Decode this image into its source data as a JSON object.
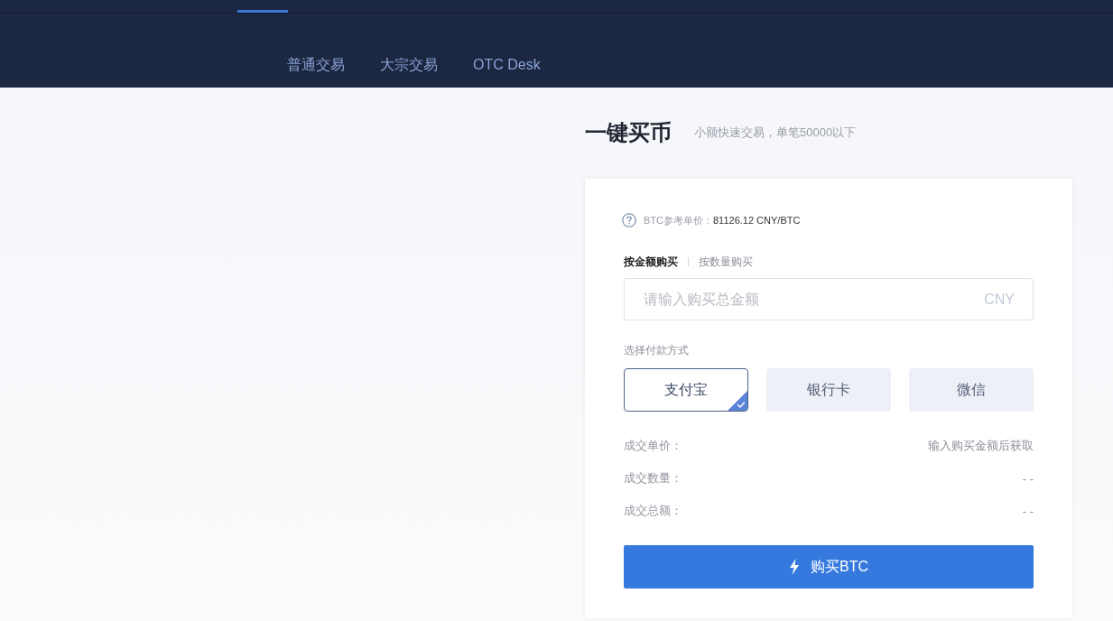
{
  "top_nav": {
    "tabs": [
      {
        "selected": true
      },
      {
        "selected": false
      },
      {
        "selected": false
      },
      {
        "selected": false
      }
    ]
  },
  "sub_nav": [
    {
      "label": "普通交易"
    },
    {
      "label": "大宗交易"
    },
    {
      "label": "OTC Desk"
    }
  ],
  "quick_buy": {
    "title": "一键买币",
    "subtitle": "小额快速交易，单笔50000以下",
    "reference_price": {
      "label": "BTC参考单价：",
      "value": "81126.12 CNY/BTC"
    },
    "modes": [
      {
        "label": "按金额购买",
        "selected": true
      },
      {
        "label": "按数量购买",
        "selected": false
      }
    ],
    "amount_field": {
      "placeholder": "请输入购买总金额",
      "unit": "CNY"
    },
    "payment_label": "选择付款方式",
    "payment_methods": [
      {
        "label": "支付宝",
        "selected": true
      },
      {
        "label": "银行卡",
        "selected": false
      },
      {
        "label": "微信",
        "selected": false
      }
    ],
    "summary": [
      {
        "label": "成交单价：",
        "value": "输入购买金额后获取"
      },
      {
        "label": "成交数量：",
        "value": "- -"
      },
      {
        "label": "成交总额：",
        "value": "- -"
      }
    ],
    "buy_button": {
      "label": "购买BTC"
    }
  }
}
